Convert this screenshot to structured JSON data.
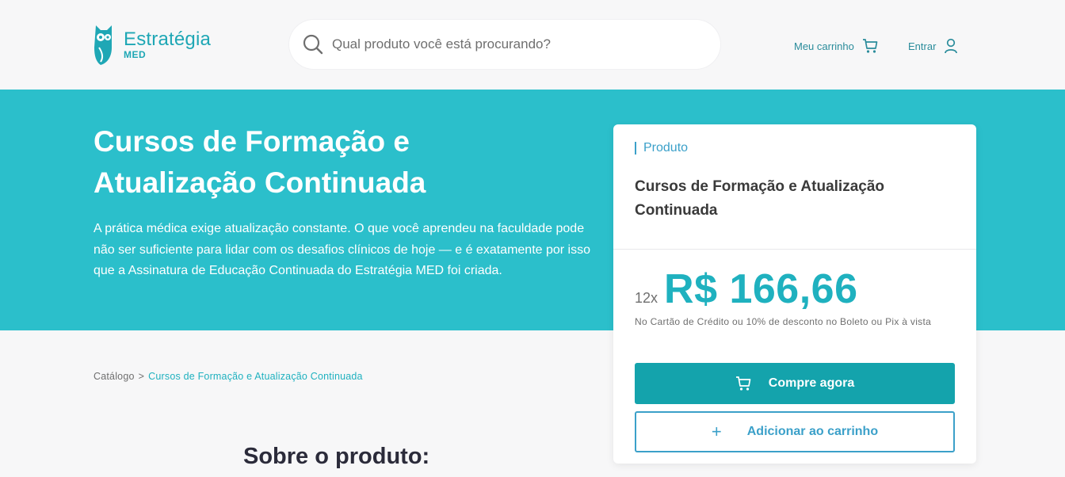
{
  "header": {
    "logo_name": "Estratégia",
    "logo_sub": "MED",
    "search": {
      "placeholder": "Qual produto você está procurando?"
    },
    "cart_label": "Meu carrinho",
    "login_label": "Entrar"
  },
  "hero": {
    "title": "Cursos de Formação e Atualização Continuada",
    "description": "A prática médica exige atualização constante. O que você aprendeu na faculdade pode não ser suficiente para lidar com os desafios clínicos de hoje — e é exatamente por isso que a Assinatura de Educação Continuada do Estratégia MED foi criada."
  },
  "card": {
    "tag": "Produto",
    "product_name": "Cursos de Formação e Atualização Continuada",
    "installments": "12x",
    "price": "R$ 166,66",
    "price_note": "No Cartão de Crédito ou 10% de desconto no Boleto ou Pix à vista",
    "buy_label": "Compre agora",
    "add_label": "Adicionar ao carrinho"
  },
  "breadcrumb": {
    "root": "Catálogo",
    "separator": ">",
    "current": "Cursos de Formação e Atualização Continuada"
  },
  "section": {
    "title": "Sobre o produto:"
  },
  "colors": {
    "accent": "#2bbfcb",
    "button": "#14a3ac",
    "link": "#3ba0c9",
    "price": "#1fb1bf"
  },
  "icons": [
    "owl-logo-icon",
    "search-icon",
    "cart-icon",
    "user-icon",
    "plus-icon"
  ]
}
